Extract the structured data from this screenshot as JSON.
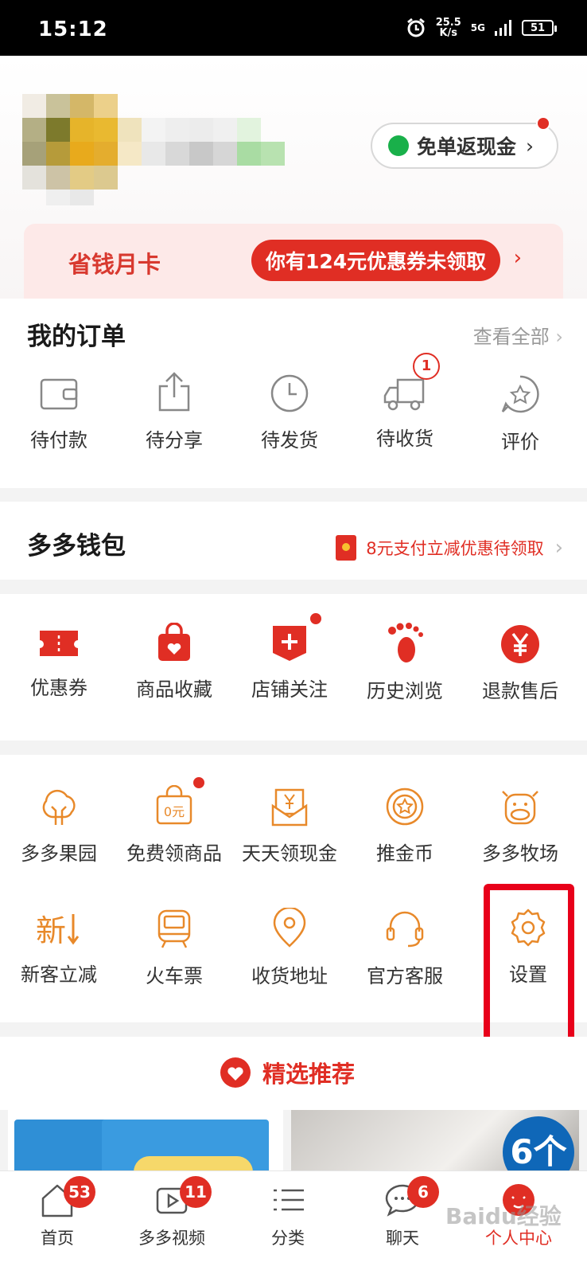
{
  "status_bar": {
    "time": "15:12",
    "speed": "25.5",
    "speed_unit": "K/s",
    "network": "5G",
    "battery": "51"
  },
  "header": {
    "cashback_label": "免单返现金",
    "month_card_title": "省钱月卡",
    "coupon_text": "你有124元优惠券未领取"
  },
  "orders": {
    "title": "我的订单",
    "view_all": "查看全部",
    "items": [
      {
        "label": "待付款",
        "icon": "wallet-icon"
      },
      {
        "label": "待分享",
        "icon": "share-icon"
      },
      {
        "label": "待发货",
        "icon": "clock-icon"
      },
      {
        "label": "待收货",
        "icon": "truck-icon",
        "badge": "1"
      },
      {
        "label": "评价",
        "icon": "star-chat-icon"
      }
    ]
  },
  "wallet": {
    "title": "多多钱包",
    "promo": "8元支付立减优惠待领取"
  },
  "quick": {
    "items": [
      {
        "label": "优惠券",
        "icon": "ticket-icon"
      },
      {
        "label": "商品收藏",
        "icon": "bag-heart-icon"
      },
      {
        "label": "店铺关注",
        "icon": "store-plus-icon"
      },
      {
        "label": "历史浏览",
        "icon": "footprint-icon"
      },
      {
        "label": "退款售后",
        "icon": "yen-icon"
      }
    ]
  },
  "services": {
    "row1": [
      {
        "label": "多多果园",
        "icon": "tree-icon"
      },
      {
        "label": "免费领商品",
        "icon": "free-bag-icon",
        "badge_text": "0元"
      },
      {
        "label": "天天领现金",
        "icon": "cash-envelope-icon"
      },
      {
        "label": "推金币",
        "icon": "coin-icon"
      },
      {
        "label": "多多牧场",
        "icon": "cow-icon"
      }
    ],
    "row2": [
      {
        "label": "新客立减",
        "icon": "new-icon",
        "icon_text": "新"
      },
      {
        "label": "火车票",
        "icon": "train-icon"
      },
      {
        "label": "收货地址",
        "icon": "location-icon"
      },
      {
        "label": "官方客服",
        "icon": "headset-icon"
      },
      {
        "label": "设置",
        "icon": "gear-icon"
      }
    ]
  },
  "recommend": {
    "label": "精选推荐"
  },
  "products": {
    "right_badge": "6个"
  },
  "tabbar": {
    "items": [
      {
        "label": "首页",
        "icon": "home-icon",
        "badge": "53"
      },
      {
        "label": "多多视频",
        "icon": "video-icon",
        "badge": "11"
      },
      {
        "label": "分类",
        "icon": "list-icon"
      },
      {
        "label": "聊天",
        "icon": "chat-icon",
        "badge": "6"
      },
      {
        "label": "个人中心",
        "icon": "profile-icon"
      }
    ]
  },
  "watermark": "Baidu经验",
  "colors": {
    "brand_red": "#e02e24",
    "service_orange": "#e8892a",
    "highlight_red": "#e8001a"
  }
}
